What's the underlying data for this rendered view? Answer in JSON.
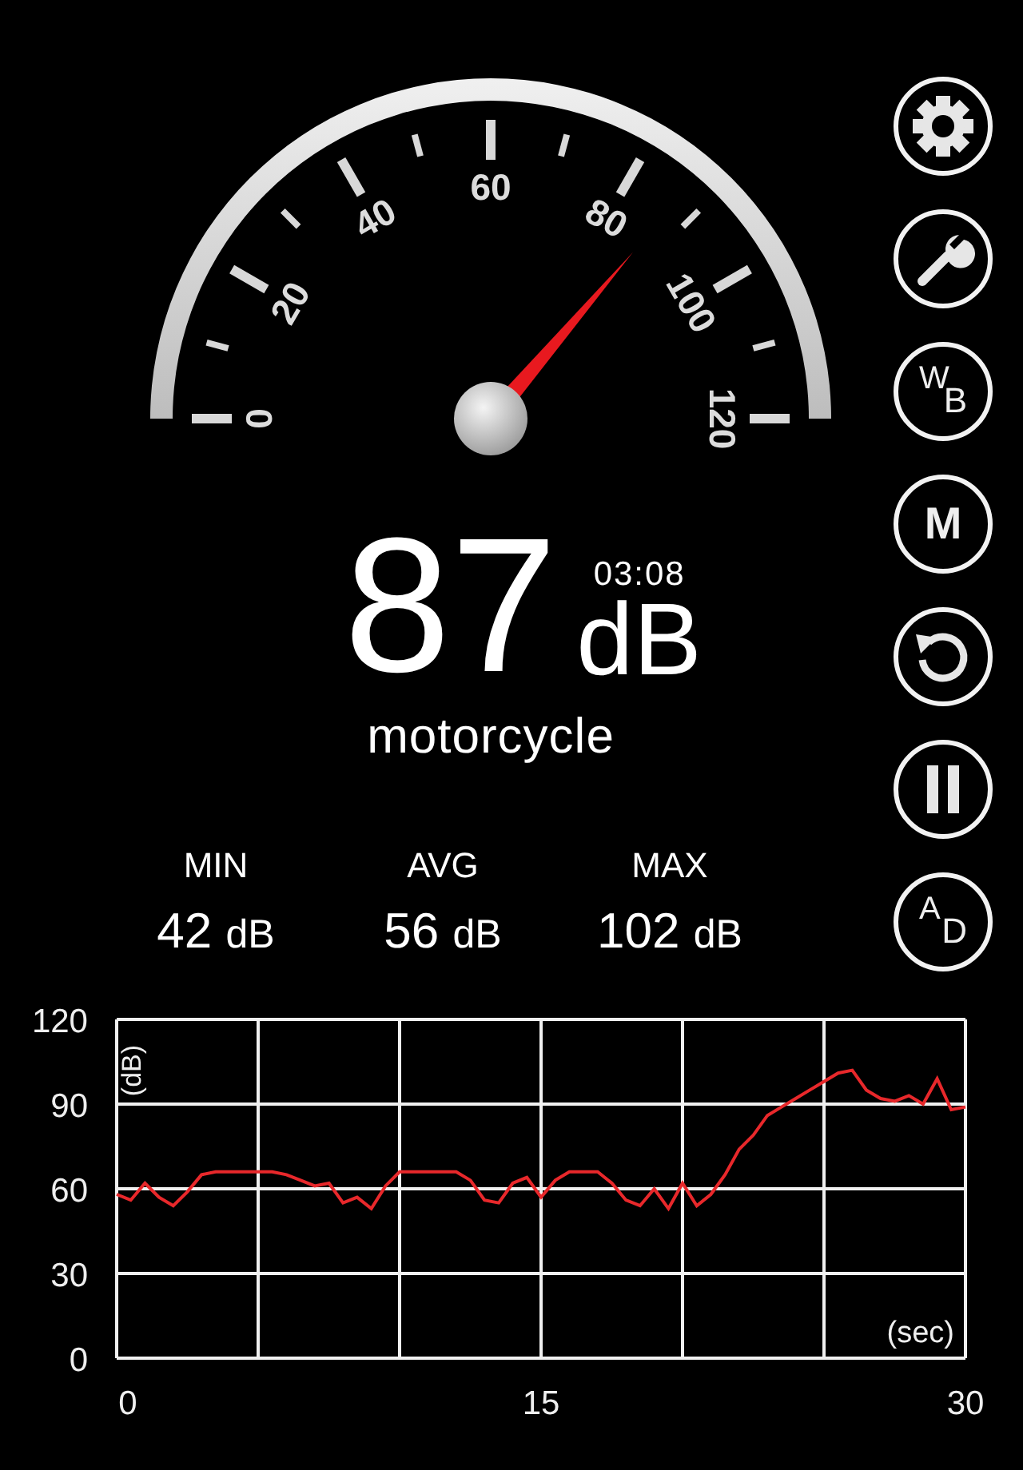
{
  "gauge": {
    "labels": [
      "0",
      "20",
      "40",
      "60",
      "80",
      "100",
      "120"
    ]
  },
  "reading": {
    "value": "87",
    "unit": "dB",
    "time": "03:08",
    "label": "motorcycle"
  },
  "stats": [
    {
      "label": "MIN",
      "value": "42",
      "unit": "dB"
    },
    {
      "label": "AVG",
      "value": "56",
      "unit": "dB"
    },
    {
      "label": "MAX",
      "value": "102",
      "unit": "dB"
    }
  ],
  "buttons": [
    {
      "kind": "settings"
    },
    {
      "kind": "tools"
    },
    {
      "kind": "letters",
      "top": "W",
      "bottom": "B"
    },
    {
      "kind": "letter",
      "label": "M"
    },
    {
      "kind": "reset"
    },
    {
      "kind": "pause"
    },
    {
      "kind": "letters",
      "top": "A",
      "bottom": "D"
    }
  ],
  "chart": {
    "chart_data": {
      "type": "line",
      "xlabel": "(sec)",
      "ylabel": "(dB)",
      "x": [
        0,
        0.5,
        1,
        1.5,
        2,
        2.5,
        3,
        3.5,
        4,
        4.5,
        5,
        5.5,
        6,
        6.5,
        7,
        7.5,
        8,
        8.5,
        9,
        9.5,
        10,
        10.5,
        11,
        11.5,
        12,
        12.5,
        13,
        13.5,
        14,
        14.5,
        15,
        15.5,
        16,
        16.5,
        17,
        17.5,
        18,
        18.5,
        19,
        19.5,
        20,
        20.5,
        21,
        21.5,
        22,
        22.5,
        23,
        23.5,
        24,
        24.5,
        25,
        25.5,
        26,
        26.5,
        27,
        27.5,
        28,
        28.5,
        29,
        29.5,
        30
      ],
      "series": [
        {
          "color": "#e8282b",
          "values": [
            58,
            56,
            62,
            57,
            54,
            59,
            65,
            66,
            66,
            66,
            66,
            66,
            65,
            63,
            61,
            62,
            55,
            57,
            53,
            61,
            66,
            66,
            66,
            66,
            66,
            63,
            56,
            55,
            62,
            64,
            57,
            63,
            66,
            66,
            66,
            62,
            56,
            54,
            60,
            53,
            62,
            54,
            58,
            65,
            74,
            79,
            86,
            89,
            92,
            95,
            98,
            101,
            102,
            95,
            92,
            91,
            93,
            90,
            99,
            88,
            89
          ]
        }
      ],
      "grid": true,
      "xlim": [
        0,
        30
      ],
      "ylim": [
        0,
        120
      ],
      "xticks": [
        0,
        15,
        30
      ],
      "yticks": [
        0,
        30,
        60,
        90,
        120
      ]
    }
  }
}
